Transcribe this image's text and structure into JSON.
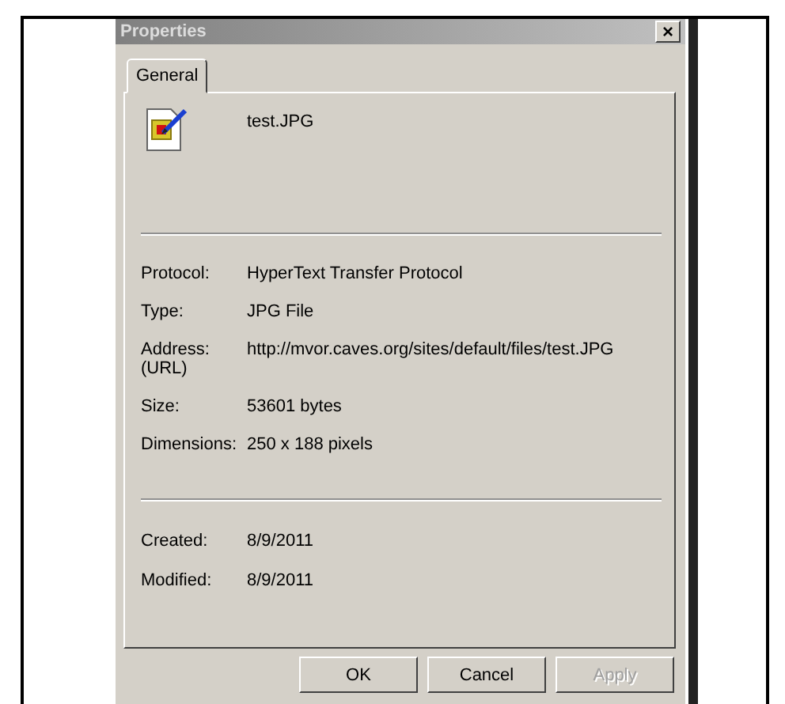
{
  "window": {
    "title": "Properties",
    "close": "×"
  },
  "tabs": [
    {
      "label": "General",
      "selected": true
    }
  ],
  "file": {
    "name": "test.JPG"
  },
  "details": [
    {
      "label": "Protocol:",
      "value": "HyperText Transfer Protocol"
    },
    {
      "label": "Type:",
      "value": "JPG File"
    },
    {
      "label": "Address:\n(URL)",
      "value": "http://mvor.caves.org/sites/default/files/test.JPG"
    },
    {
      "label": "Size:",
      "value": "53601 bytes"
    },
    {
      "label": "Dimensions:",
      "value": "250  x  188  pixels"
    }
  ],
  "dates": [
    {
      "label": "Created:",
      "value": "8/9/2011"
    },
    {
      "label": "Modified:",
      "value": "8/9/2011"
    }
  ],
  "buttons": [
    {
      "label": "OK",
      "disabled": false
    },
    {
      "label": "Cancel",
      "disabled": false
    },
    {
      "label": "Apply",
      "disabled": true
    }
  ]
}
